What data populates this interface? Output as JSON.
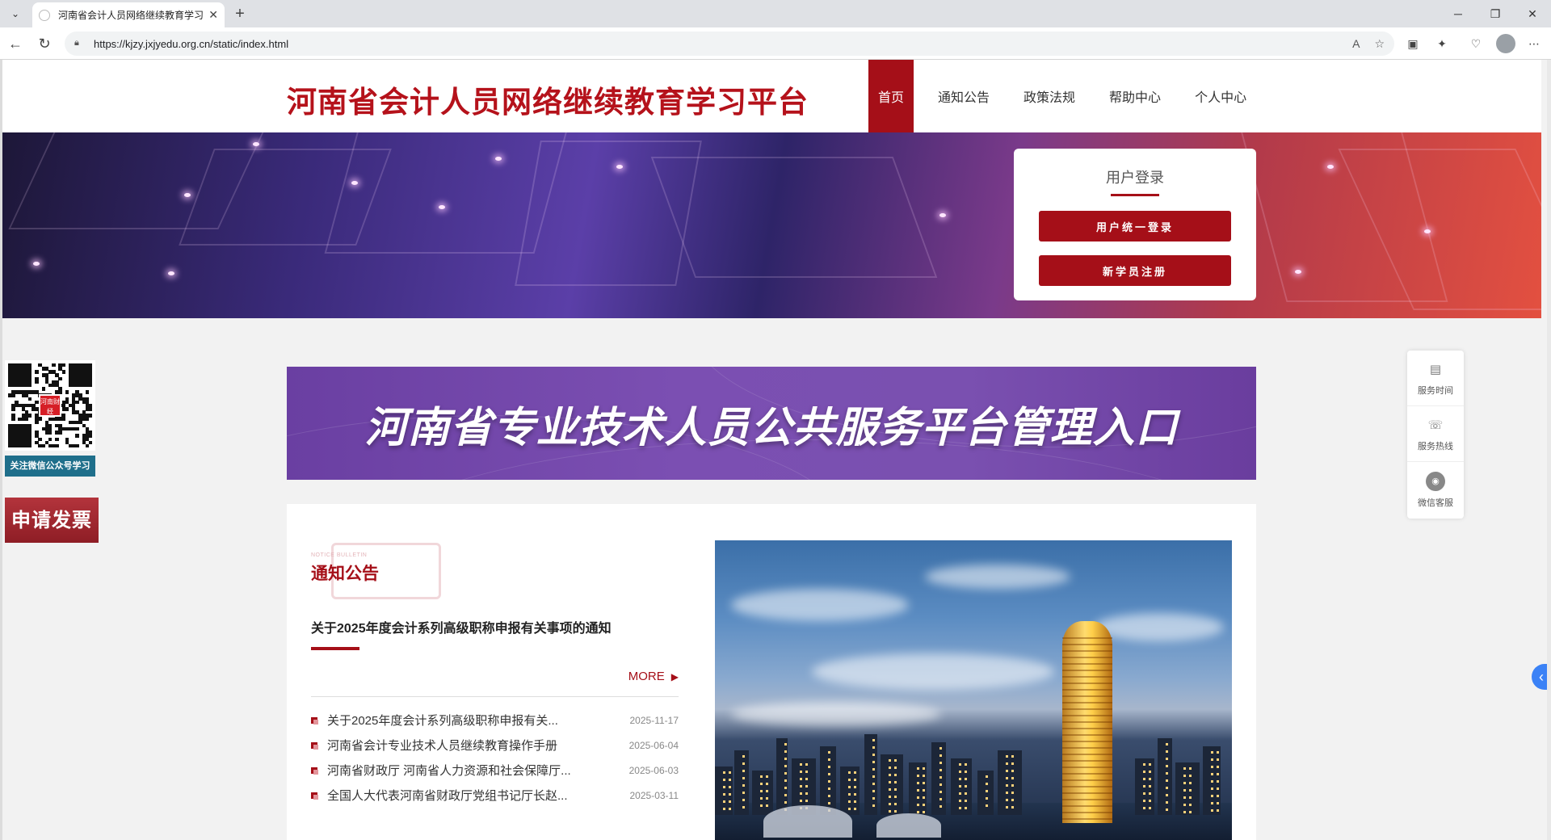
{
  "browser": {
    "tab_title": "河南省会计人员网络继续教育学习",
    "url": "https://kjzy.jxjyedu.org.cn/static/index.html"
  },
  "site": {
    "title": "河南省会计人员网络继续教育学习平台",
    "nav": [
      "首页",
      "通知公告",
      "政策法规",
      "帮助中心",
      "个人中心"
    ]
  },
  "login": {
    "title": "用户登录",
    "unified_login": "用户统一登录",
    "register": "新学员注册"
  },
  "side": {
    "qr_center_text": "河南财经",
    "qr_caption": "关注微信公众号学习",
    "invoice": "申请发票"
  },
  "service": {
    "items": [
      {
        "label": "服务时间",
        "icon": "service-time-icon"
      },
      {
        "label": "服务热线",
        "icon": "phone-icon"
      },
      {
        "label": "微信客服",
        "icon": "wechat-icon"
      }
    ]
  },
  "portal": {
    "text": "河南省专业技术人员公共服务平台管理入口"
  },
  "notice": {
    "en_label": "NOTICE BULLETIN",
    "cn_label": "通知公告",
    "featured": "关于2025年度会计系列高级职称申报有关事项的通知",
    "more": "MORE",
    "items": [
      {
        "title": "关于2025年度会计系列高级职称申报有关...",
        "date": "2025-11-17"
      },
      {
        "title": "河南省会计专业技术人员继续教育操作手册",
        "date": "2025-06-04"
      },
      {
        "title": "河南省财政厅 河南省人力资源和社会保障厅...",
        "date": "2025-06-03"
      },
      {
        "title": "全国人大代表河南省财政厅党组书记厅长赵...",
        "date": "2025-03-11"
      }
    ]
  },
  "colors": {
    "brand_red": "#a50f18",
    "portal_purple": "#6a3fa2"
  }
}
